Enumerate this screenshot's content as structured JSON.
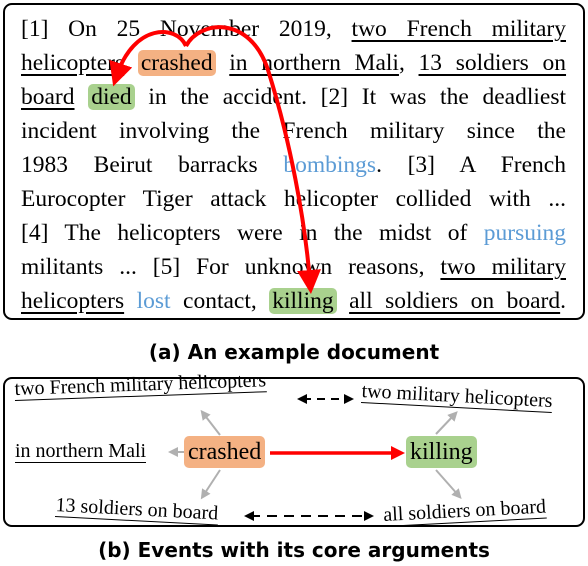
{
  "document": {
    "lines": [
      [
        {
          "t": "[1] On 25 November 2019, "
        },
        {
          "t": "two French military",
          "u": true
        }
      ],
      [
        {
          "t": "helicopters",
          "u": true
        },
        {
          "t": " "
        },
        {
          "t": "crashed",
          "trig": "orange"
        },
        {
          "t": " "
        },
        {
          "t": "in northern Mali",
          "u": true
        },
        {
          "t": ", "
        },
        {
          "t": "13 soldiers on",
          "u": true
        }
      ],
      [
        {
          "t": "board",
          "u": true
        },
        {
          "t": " "
        },
        {
          "t": "died",
          "trig": "green"
        },
        {
          "t": " in the accident. [2] It was the deadliest"
        }
      ],
      [
        {
          "t": "incident involving the French military since the"
        }
      ],
      [
        {
          "t": "1983 Beirut barracks "
        },
        {
          "t": "bombings",
          "blue": true
        },
        {
          "t": ". [3] A French"
        }
      ],
      [
        {
          "t": "Eurocopter Tiger attack helicopter collided with ..."
        }
      ],
      [
        {
          "t": "[4] The helicopters were in the midst of "
        },
        {
          "t": "pursuing",
          "blue": true
        }
      ],
      [
        {
          "t": "militants ... [5] For unknown reasons, "
        },
        {
          "t": "two military",
          "u": true
        }
      ],
      [
        {
          "t": "helicopters",
          "u": true
        },
        {
          "t": " "
        },
        {
          "t": "lost",
          "blue": true
        },
        {
          "t": " contact, "
        },
        {
          "t": "killing",
          "trig": "green"
        },
        {
          "t": " "
        },
        {
          "t": "all soldiers on board",
          "u": true
        },
        {
          "t": "."
        }
      ]
    ]
  },
  "captions": {
    "a": "(a) An example document",
    "b": "(b) Events with its core arguments"
  },
  "events": {
    "trigger_left": "crashed",
    "trigger_right": "killing",
    "args_left": {
      "top": "two French military helicopters",
      "middle": "in northern Mali",
      "bottom": "13 soldiers on board"
    },
    "args_right": {
      "top": "two military helicopters",
      "bottom": "all soldiers on board"
    }
  },
  "colors": {
    "trigger_orange": "#f4b183",
    "trigger_green": "#a9d18e",
    "event_link_red": "#ff0000",
    "non_core_blue": "#5b9bd5",
    "arg_arrow_gray": "#b0b0b0"
  }
}
